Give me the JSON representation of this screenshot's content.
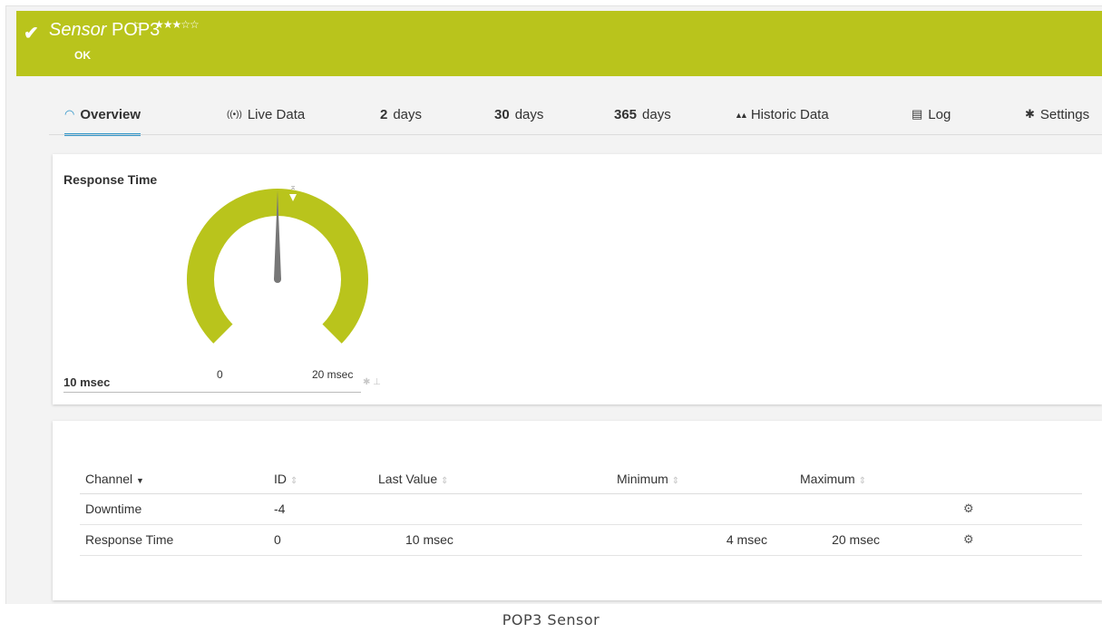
{
  "header": {
    "check_icon": "check-icon",
    "title_italic": "Sensor",
    "title_name": "POP3",
    "flag_icon": "flag-icon",
    "stars": "★★★☆☆",
    "status": "OK",
    "color": "#b9c41c"
  },
  "tabs": [
    {
      "icon": "◠",
      "label": "Overview"
    },
    {
      "icon": "((•))",
      "label": "Live Data"
    },
    {
      "bold": "2",
      "label": "days"
    },
    {
      "bold": "30",
      "label": "days"
    },
    {
      "bold": "365",
      "label": "days"
    },
    {
      "icon": "▲▲",
      "label": "Historic Data"
    },
    {
      "icon": "▤",
      "label": "Log"
    },
    {
      "icon": "✱",
      "label": "Settings"
    }
  ],
  "gauge": {
    "title": "Response Time",
    "value": "10 msec",
    "min": "0",
    "max": "20 msec",
    "fraction": 0.5,
    "color": "#b9c41c"
  },
  "table": {
    "headers": [
      "Channel",
      "ID",
      "Last Value",
      "Minimum",
      "Maximum"
    ],
    "rows": [
      {
        "channel": "Downtime",
        "id": "-4",
        "last": "",
        "min": "",
        "max": ""
      },
      {
        "channel": "Response Time",
        "id": "0",
        "last": "10 msec",
        "min": "4 msec",
        "max": "20 msec"
      }
    ]
  },
  "caption": "POP3 Sensor"
}
